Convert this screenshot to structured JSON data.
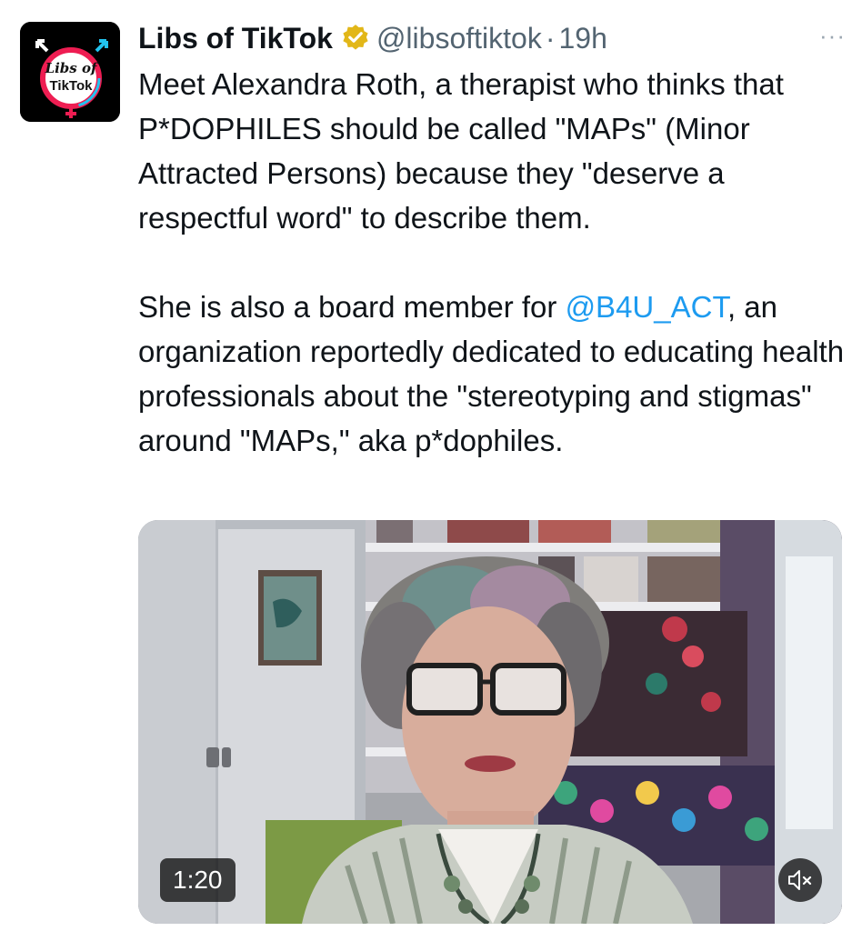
{
  "tweet": {
    "author": {
      "display_name": "Libs of TikTok",
      "handle": "@libsoftiktok",
      "avatar_text_line1": "Libs of",
      "avatar_text_line2": "TikTok"
    },
    "separator": "·",
    "time": "19h",
    "more_label": "···",
    "paragraph1": "Meet Alexandra Roth, a therapist who thinks that P*DOPHILES should be called \"MAPs\" (Minor Attracted Persons) because they \"deserve a respectful word\" to describe them.",
    "paragraph2_before": "She is also a board member for ",
    "paragraph2_mention": "@B4U_ACT",
    "paragraph2_after": ", an organization reportedly dedicated to educating health professionals about the \"stereotyping and stigmas\" around \"MAPs,\" aka p*dophiles.",
    "video": {
      "duration": "1:20",
      "mute_icon": "speaker-muted-icon"
    }
  },
  "colors": {
    "text": "#0f1419",
    "secondary": "#536471",
    "link": "#1d9bf0",
    "verified_badge": "#e2b719"
  }
}
